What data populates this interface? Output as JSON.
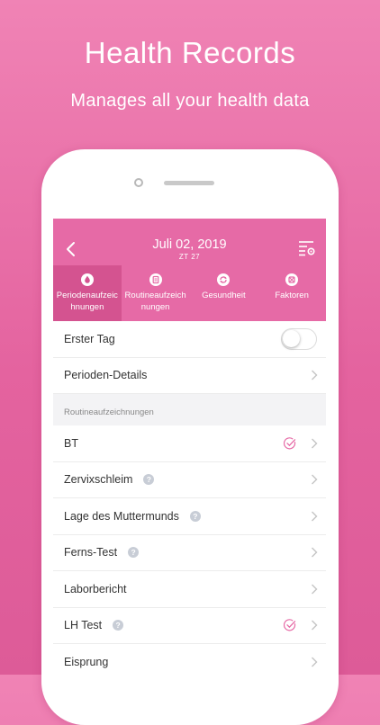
{
  "promo": {
    "title": "Health Records",
    "subtitle": "Manages all your health data"
  },
  "header": {
    "date": "Juli 02, 2019",
    "cycle_day": "ZT 27",
    "back_icon": "chevron-left-icon",
    "settings_icon": "list-settings-icon",
    "accent_color": "#e66aa6",
    "active_tab_color": "#d45390"
  },
  "tabs": [
    {
      "label": "Periodenaufzeichnungen",
      "icon": "drop-icon",
      "active": true
    },
    {
      "label": "Routineaufzeichnungen",
      "icon": "clipboard-icon",
      "active": false
    },
    {
      "label": "Gesundheit",
      "icon": "refresh-icon",
      "active": false
    },
    {
      "label": "Faktoren",
      "icon": "factor-icon",
      "active": false
    }
  ],
  "rows_top": [
    {
      "label": "Erster Tag",
      "toggle": "off"
    },
    {
      "label": "Perioden-Details"
    }
  ],
  "section": {
    "title": "Routineaufzeichnungen"
  },
  "rows": [
    {
      "label": "BT",
      "checked": true,
      "help": false
    },
    {
      "label": "Zervixschleim",
      "checked": false,
      "help": true
    },
    {
      "label": "Lage des Muttermunds",
      "checked": false,
      "help": true
    },
    {
      "label": "Ferns-Test",
      "checked": false,
      "help": true
    },
    {
      "label": "Laborbericht",
      "checked": false,
      "help": false
    },
    {
      "label": "LH Test",
      "checked": true,
      "help": true
    },
    {
      "label": "Eisprung",
      "checked": false,
      "help": false
    }
  ],
  "help_glyph": "?"
}
